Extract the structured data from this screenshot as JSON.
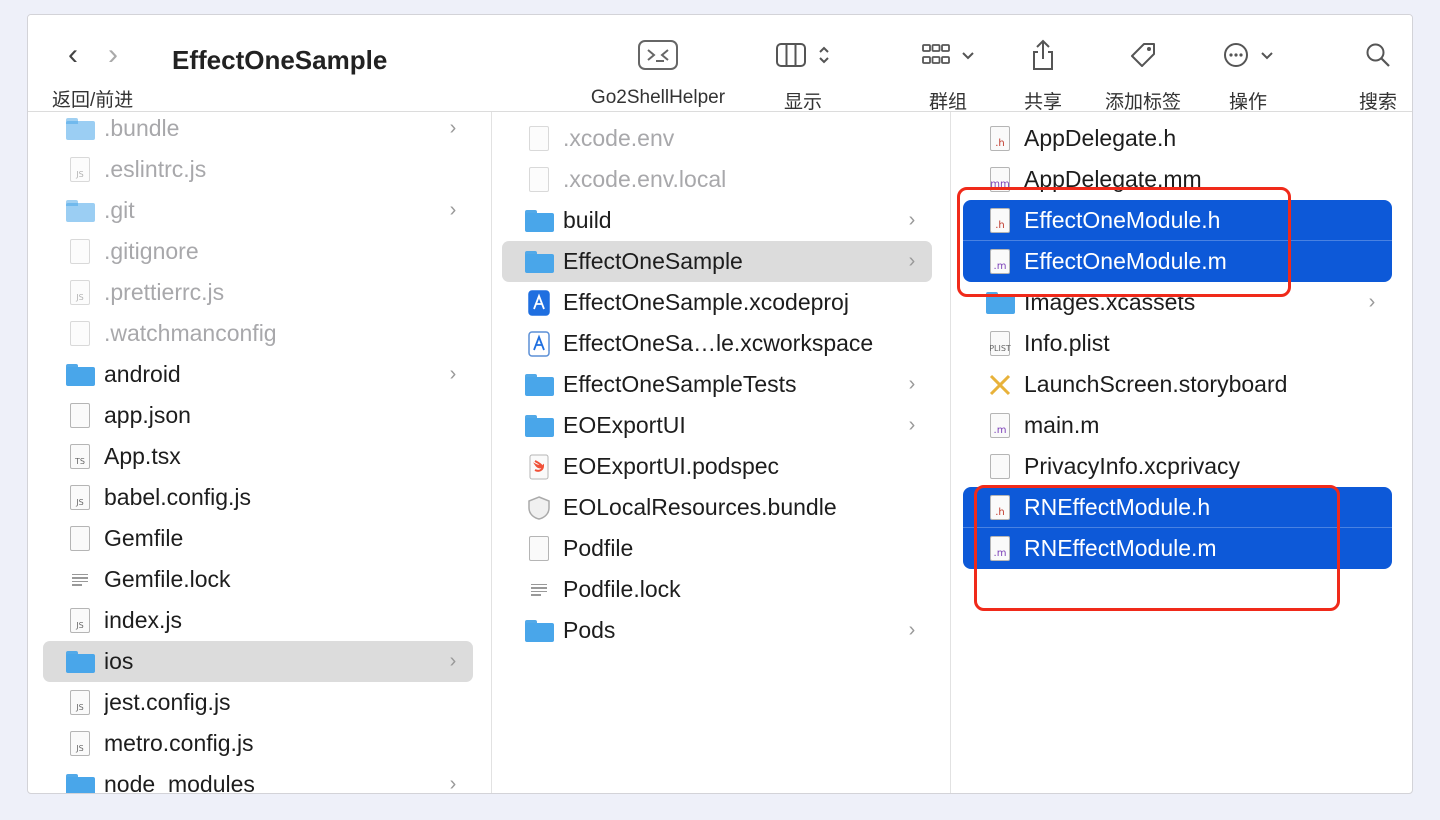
{
  "window": {
    "title": "EffectOneSample"
  },
  "toolbar": {
    "nav_label": "返回/前进",
    "back_icon": "‹",
    "forward_icon": "›",
    "items": [
      {
        "label": "Go2ShellHelper",
        "icon": "terminal-icon"
      },
      {
        "label": "显示",
        "icon": "columns-view-icon"
      },
      {
        "label": "群组",
        "icon": "group-grid-icon"
      },
      {
        "label": "共享",
        "icon": "share-icon"
      },
      {
        "label": "添加标签",
        "icon": "tag-icon"
      },
      {
        "label": "操作",
        "icon": "more-actions-icon"
      },
      {
        "label": "搜索",
        "icon": "search-icon"
      }
    ]
  },
  "columns": [
    {
      "items": [
        {
          "name": ".bundle",
          "kind": "folder",
          "dim": true,
          "chevron": true
        },
        {
          "name": ".eslintrc.js",
          "kind": "file",
          "badge": "JS",
          "dim": true
        },
        {
          "name": ".git",
          "kind": "folder",
          "dim": true,
          "chevron": true
        },
        {
          "name": ".gitignore",
          "kind": "file",
          "badge": "",
          "dim": true
        },
        {
          "name": ".prettierrc.js",
          "kind": "file",
          "badge": "JS",
          "dim": true
        },
        {
          "name": ".watchmanconfig",
          "kind": "file",
          "badge": "",
          "dim": true
        },
        {
          "name": "android",
          "kind": "folder",
          "chevron": true
        },
        {
          "name": "app.json",
          "kind": "file",
          "badge": ""
        },
        {
          "name": "App.tsx",
          "kind": "file",
          "badge": "TS"
        },
        {
          "name": "babel.config.js",
          "kind": "file",
          "badge": "JS"
        },
        {
          "name": "Gemfile",
          "kind": "file",
          "badge": ""
        },
        {
          "name": "Gemfile.lock",
          "kind": "text"
        },
        {
          "name": "index.js",
          "kind": "file",
          "badge": "JS"
        },
        {
          "name": "ios",
          "kind": "folder",
          "chevron": true,
          "state": "hl"
        },
        {
          "name": "jest.config.js",
          "kind": "file",
          "badge": "JS"
        },
        {
          "name": "metro.config.js",
          "kind": "file",
          "badge": "JS"
        },
        {
          "name": "node_modules",
          "kind": "folder",
          "chevron": true
        }
      ]
    },
    {
      "items": [
        {
          "name": ".xcode.env",
          "kind": "file",
          "badge": "",
          "dim": true
        },
        {
          "name": ".xcode.env.local",
          "kind": "file",
          "badge": "",
          "dim": true
        },
        {
          "name": "build",
          "kind": "folder",
          "chevron": true
        },
        {
          "name": "EffectOneSample",
          "kind": "folder",
          "chevron": true,
          "state": "hl"
        },
        {
          "name": "EffectOneSample.xcodeproj",
          "kind": "xcodeproj"
        },
        {
          "name": "EffectOneSa…le.xcworkspace",
          "kind": "xcworkspace"
        },
        {
          "name": "EffectOneSampleTests",
          "kind": "folder",
          "chevron": true
        },
        {
          "name": "EOExportUI",
          "kind": "folder",
          "chevron": true
        },
        {
          "name": "EOExportUI.podspec",
          "kind": "swift"
        },
        {
          "name": "EOLocalResources.bundle",
          "kind": "bundle"
        },
        {
          "name": "Podfile",
          "kind": "file",
          "badge": ""
        },
        {
          "name": "Podfile.lock",
          "kind": "text"
        },
        {
          "name": "Pods",
          "kind": "folder",
          "chevron": true
        }
      ]
    },
    {
      "items": [
        {
          "name": "AppDelegate.h",
          "kind": "file",
          "badge": ".h",
          "cls": "h"
        },
        {
          "name": "AppDelegate.mm",
          "kind": "file",
          "badge": "mm",
          "cls": "m"
        },
        {
          "name": "EffectOneModule.h",
          "kind": "file",
          "badge": ".h",
          "cls": "h",
          "state": "sel"
        },
        {
          "name": "EffectOneModule.m",
          "kind": "file",
          "badge": ".m",
          "cls": "m",
          "state": "sel"
        },
        {
          "name": "Images.xcassets",
          "kind": "folder",
          "chevron": true
        },
        {
          "name": "Info.plist",
          "kind": "file",
          "badge": "PLIST"
        },
        {
          "name": "LaunchScreen.storyboard",
          "kind": "storyboard"
        },
        {
          "name": "main.m",
          "kind": "file",
          "badge": ".m",
          "cls": "m"
        },
        {
          "name": "PrivacyInfo.xcprivacy",
          "kind": "file",
          "badge": ""
        },
        {
          "name": "RNEffectModule.h",
          "kind": "file",
          "badge": ".h",
          "cls": "h",
          "state": "sel"
        },
        {
          "name": "RNEffectModule.m",
          "kind": "file",
          "badge": ".m",
          "cls": "m",
          "state": "sel"
        }
      ]
    }
  ],
  "colors": {
    "selection": "#0d59d8",
    "highlight": "#dcdcdc",
    "annotation": "#f02a1a",
    "folder": "#49a6ea"
  }
}
